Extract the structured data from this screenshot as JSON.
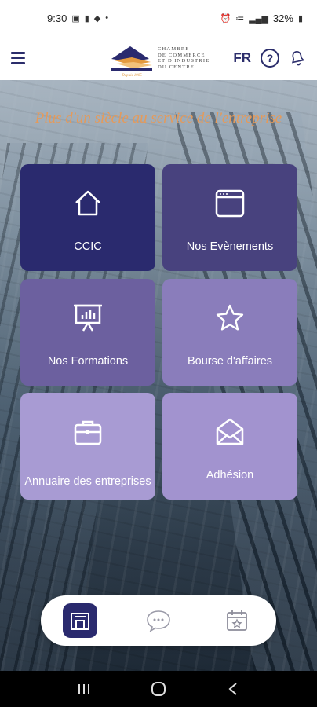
{
  "status_bar": {
    "time": "9:30",
    "battery": "32%"
  },
  "header": {
    "logo_text_lines": [
      "CHAMBRE",
      "DE COMMERCE",
      "ET D'INDUSTRIE",
      "DU CENTRE"
    ],
    "language": "FR",
    "help_label": "?"
  },
  "tagline": "Plus d'un siècle au service de l'entreprise",
  "tiles": [
    {
      "label": "CCIC",
      "icon": "home-icon"
    },
    {
      "label": "Nos Evènements",
      "icon": "browser-window-icon"
    },
    {
      "label": "Nos Formations",
      "icon": "presentation-board-icon"
    },
    {
      "label": "Bourse d'affaires",
      "icon": "star-icon"
    },
    {
      "label": "Annuaire des entreprises",
      "icon": "briefcase-icon"
    },
    {
      "label": "Adhésion",
      "icon": "envelope-icon"
    }
  ],
  "tabbar": {
    "tabs": [
      {
        "icon": "storefront-icon",
        "active": true
      },
      {
        "icon": "chat-bubble-icon",
        "active": false
      },
      {
        "icon": "calendar-star-icon",
        "active": false
      }
    ]
  },
  "colors": {
    "brand_dark": "#2a2a6e",
    "accent_orange": "#e59a5a"
  }
}
